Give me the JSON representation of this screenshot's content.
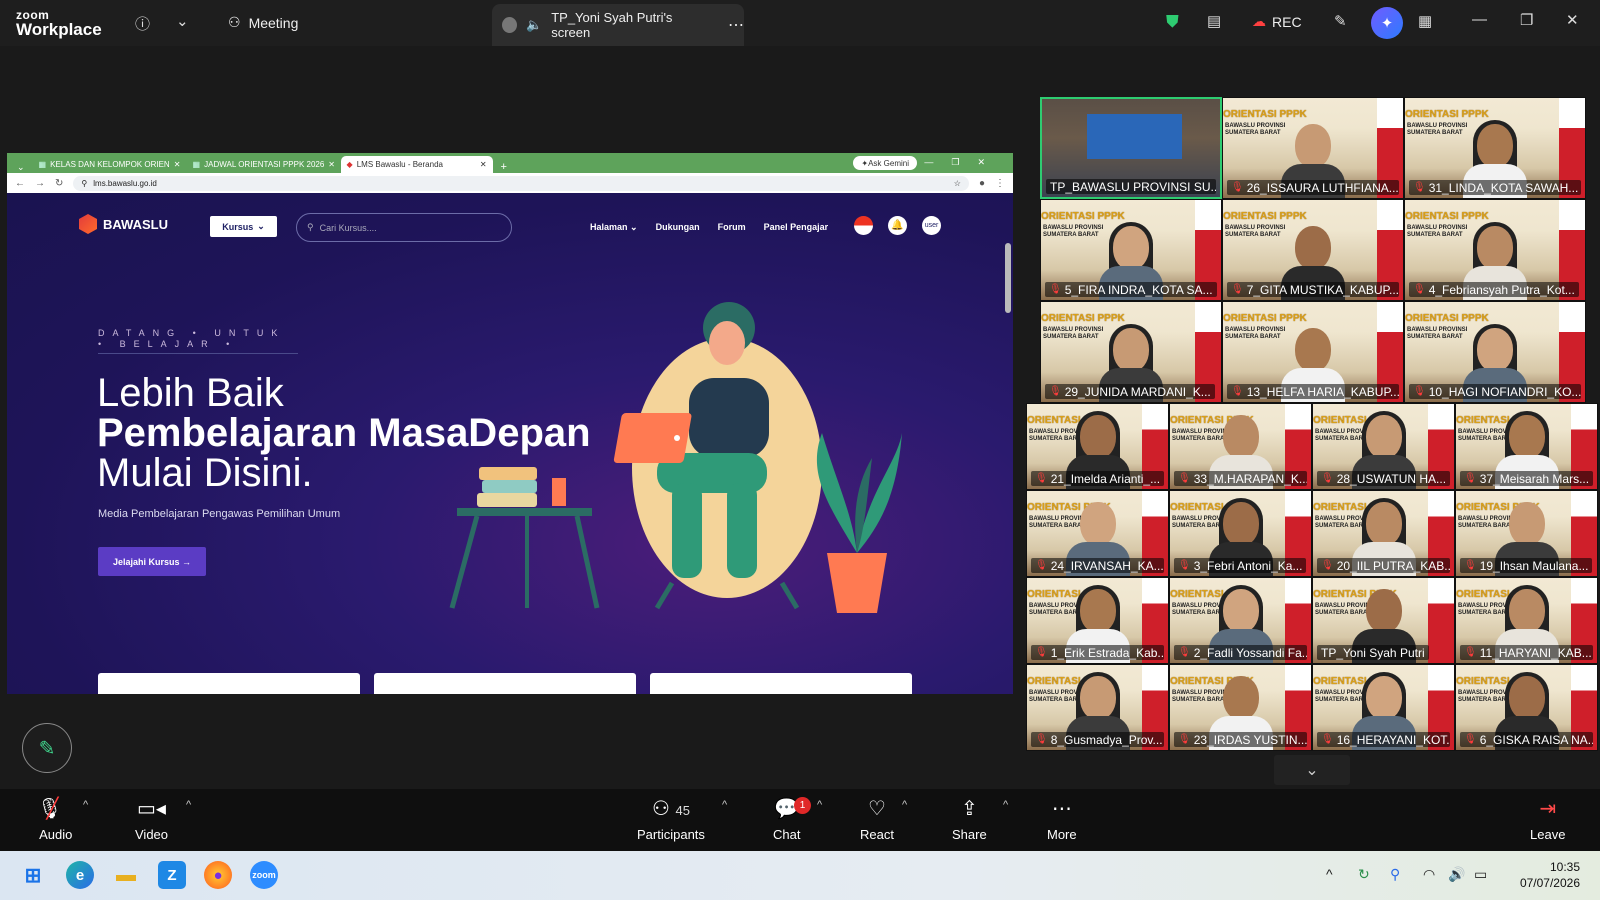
{
  "zoom": {
    "brand_top": "zoom",
    "brand_bottom": "Workplace",
    "meeting_label": "Meeting",
    "screen_share_label": "TP_Yoni Syah Putri's screen",
    "rec_label": "REC"
  },
  "browser": {
    "tabs": [
      {
        "label": "KELAS DAN KELOMPOK ORIEN"
      },
      {
        "label": "JADWAL ORIENTASI PPPK 2026"
      },
      {
        "label": "LMS Bawaslu - Beranda"
      }
    ],
    "ask_gemini": "Ask Gemini",
    "url": "lms.bawaslu.go.id"
  },
  "site": {
    "logo_text": "BAWASLU",
    "kursus_button": "Kursus",
    "search_placeholder": "Cari Kursus....",
    "nav": [
      "Halaman",
      "Dukungan",
      "Forum",
      "Panel Pengajar"
    ],
    "user_label": "user",
    "eyebrow": "DATANG • UNTUK • BELAJAR •",
    "headline_1": "Lebih Baik",
    "headline_2": "Pembelajaran MasaDepan",
    "headline_3": "Mulai Disini.",
    "subtitle": "Media Pembelajaran Pengawas Pemilihan Umum",
    "cta": "Jelajahi Kursus →"
  },
  "participants_tiles": [
    {
      "name": "TP_BAWASLU PROVINSI SU...",
      "muted": false
    },
    {
      "name": "26_ISSAURA LUTHFIANA...",
      "muted": true
    },
    {
      "name": "31_LINDA_KOTA SAWAH...",
      "muted": true
    },
    {
      "name": "5_FIRA INDRA_KOTA SA...",
      "muted": true
    },
    {
      "name": "7_GITA MUSTIKA_KABUP...",
      "muted": true
    },
    {
      "name": "4_Febriansyah Putra_Kot...",
      "muted": true
    },
    {
      "name": "29_JUNIDA MARDANI_K...",
      "muted": true
    },
    {
      "name": "13_HELFA HARIA_KABUP...",
      "muted": true
    },
    {
      "name": "10_HAGI NOFIANDRI_KO...",
      "muted": true
    },
    {
      "name": "21_Imelda Arianti_...",
      "muted": true
    },
    {
      "name": "33_M.HARAPAN_K...",
      "muted": true
    },
    {
      "name": "28_USWATUN HA...",
      "muted": true
    },
    {
      "name": "37_Meisarah Mars...",
      "muted": true
    },
    {
      "name": "24_IRVANSAH_KA...",
      "muted": true
    },
    {
      "name": "3_Febri Antoni_Ka...",
      "muted": true
    },
    {
      "name": "20_IIL PUTRA_KAB...",
      "muted": true
    },
    {
      "name": "19_Ihsan Maulana...",
      "muted": true
    },
    {
      "name": "1_Erik Estrada_Kab...",
      "muted": true
    },
    {
      "name": "2_Fadli Yossandi Fa...",
      "muted": true
    },
    {
      "name": "TP_Yoni Syah Putri",
      "muted": false
    },
    {
      "name": "11_HARYANI_KAB...",
      "muted": true
    },
    {
      "name": "8_Gusmadya_Prov...",
      "muted": true
    },
    {
      "name": "23_IRDAS YUSTIN...",
      "muted": true
    },
    {
      "name": "16_HERAYANI_KOT...",
      "muted": true
    },
    {
      "name": "6_GISKA RAISA NA...",
      "muted": true
    }
  ],
  "poster_text": {
    "line1": "ORIENTASI PPPK",
    "line2": "BAWASLU PROVINSI SUMATERA BARAT"
  },
  "toolbar": {
    "audio": "Audio",
    "video": "Video",
    "participants": "Participants",
    "participants_count": "45",
    "chat": "Chat",
    "chat_badge": "1",
    "react": "React",
    "share": "Share",
    "more": "More",
    "leave": "Leave"
  },
  "taskbar": {
    "time": "10:35",
    "date": "07/07/2026"
  }
}
